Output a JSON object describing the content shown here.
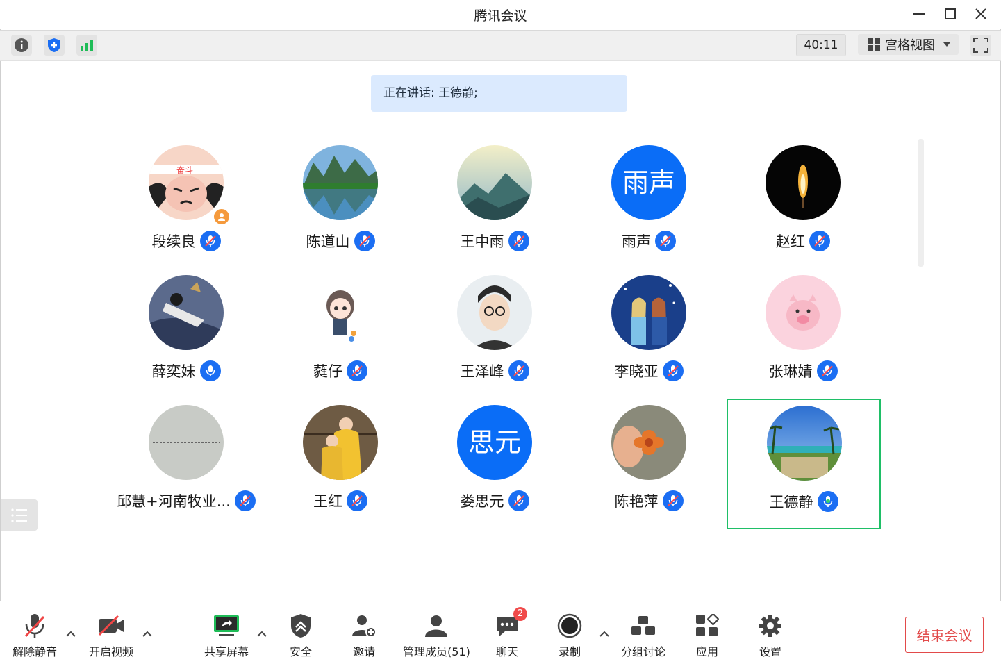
{
  "window": {
    "title": "腾讯会议"
  },
  "toolbar": {
    "timer": "40:11",
    "view_label": "宫格视图"
  },
  "speaking": {
    "text": "正在讲话: 王德静;"
  },
  "participants": [
    {
      "name": "段续良",
      "muted": true,
      "host": true
    },
    {
      "name": "陈道山",
      "muted": true
    },
    {
      "name": "王中雨",
      "muted": true
    },
    {
      "name": "雨声",
      "muted": true,
      "avatar_text": "雨声"
    },
    {
      "name": "赵红",
      "muted": true
    },
    {
      "name": "薛奕妹",
      "muted": false
    },
    {
      "name": "蕤仔",
      "muted": true
    },
    {
      "name": "王泽峰",
      "muted": true
    },
    {
      "name": "李晓亚",
      "muted": true
    },
    {
      "name": "张琳婧",
      "muted": true
    },
    {
      "name": "邱慧+河南牧业...",
      "muted": true
    },
    {
      "name": "王红",
      "muted": true
    },
    {
      "name": "娄思元",
      "muted": true,
      "avatar_text": "思元"
    },
    {
      "name": "陈艳萍",
      "muted": true
    },
    {
      "name": "王德静",
      "muted": false,
      "speaking": true
    }
  ],
  "bottombar": {
    "unmute": "解除静音",
    "start_video": "开启视频",
    "share_screen": "共享屏幕",
    "security": "安全",
    "invite": "邀请",
    "manage_members": "管理成员(51)",
    "chat": "聊天",
    "chat_badge": "2",
    "record": "录制",
    "breakout": "分组讨论",
    "apps": "应用",
    "settings": "设置",
    "end_meeting": "结束会议"
  },
  "colors": {
    "accent": "#1b6ef3",
    "active_border": "#1fbf67",
    "end": "#e24a4a"
  }
}
